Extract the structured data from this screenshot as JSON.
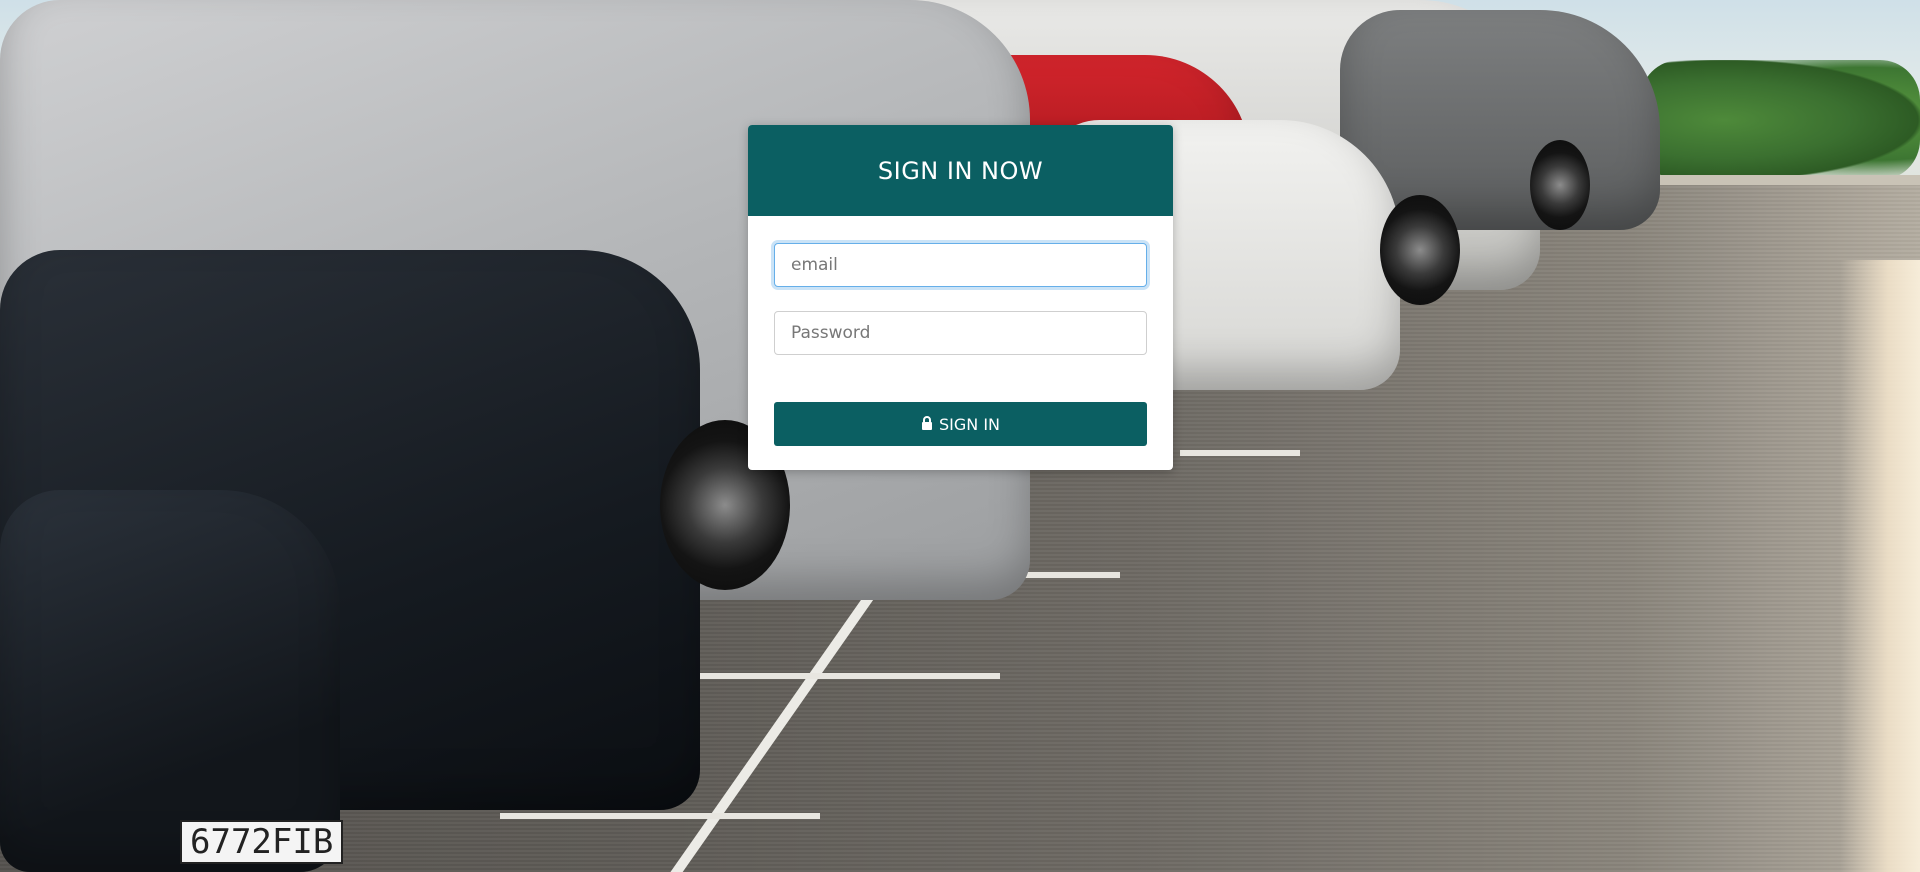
{
  "login": {
    "title": "SIGN IN NOW",
    "email_placeholder": "email",
    "password_placeholder": "Password",
    "submit_label": "SIGN IN",
    "submit_icon": "lock-icon"
  },
  "background": {
    "plate_text": "6772FIB"
  },
  "colors": {
    "brand": "#0b5f62",
    "focus_ring": "#66afe9"
  }
}
